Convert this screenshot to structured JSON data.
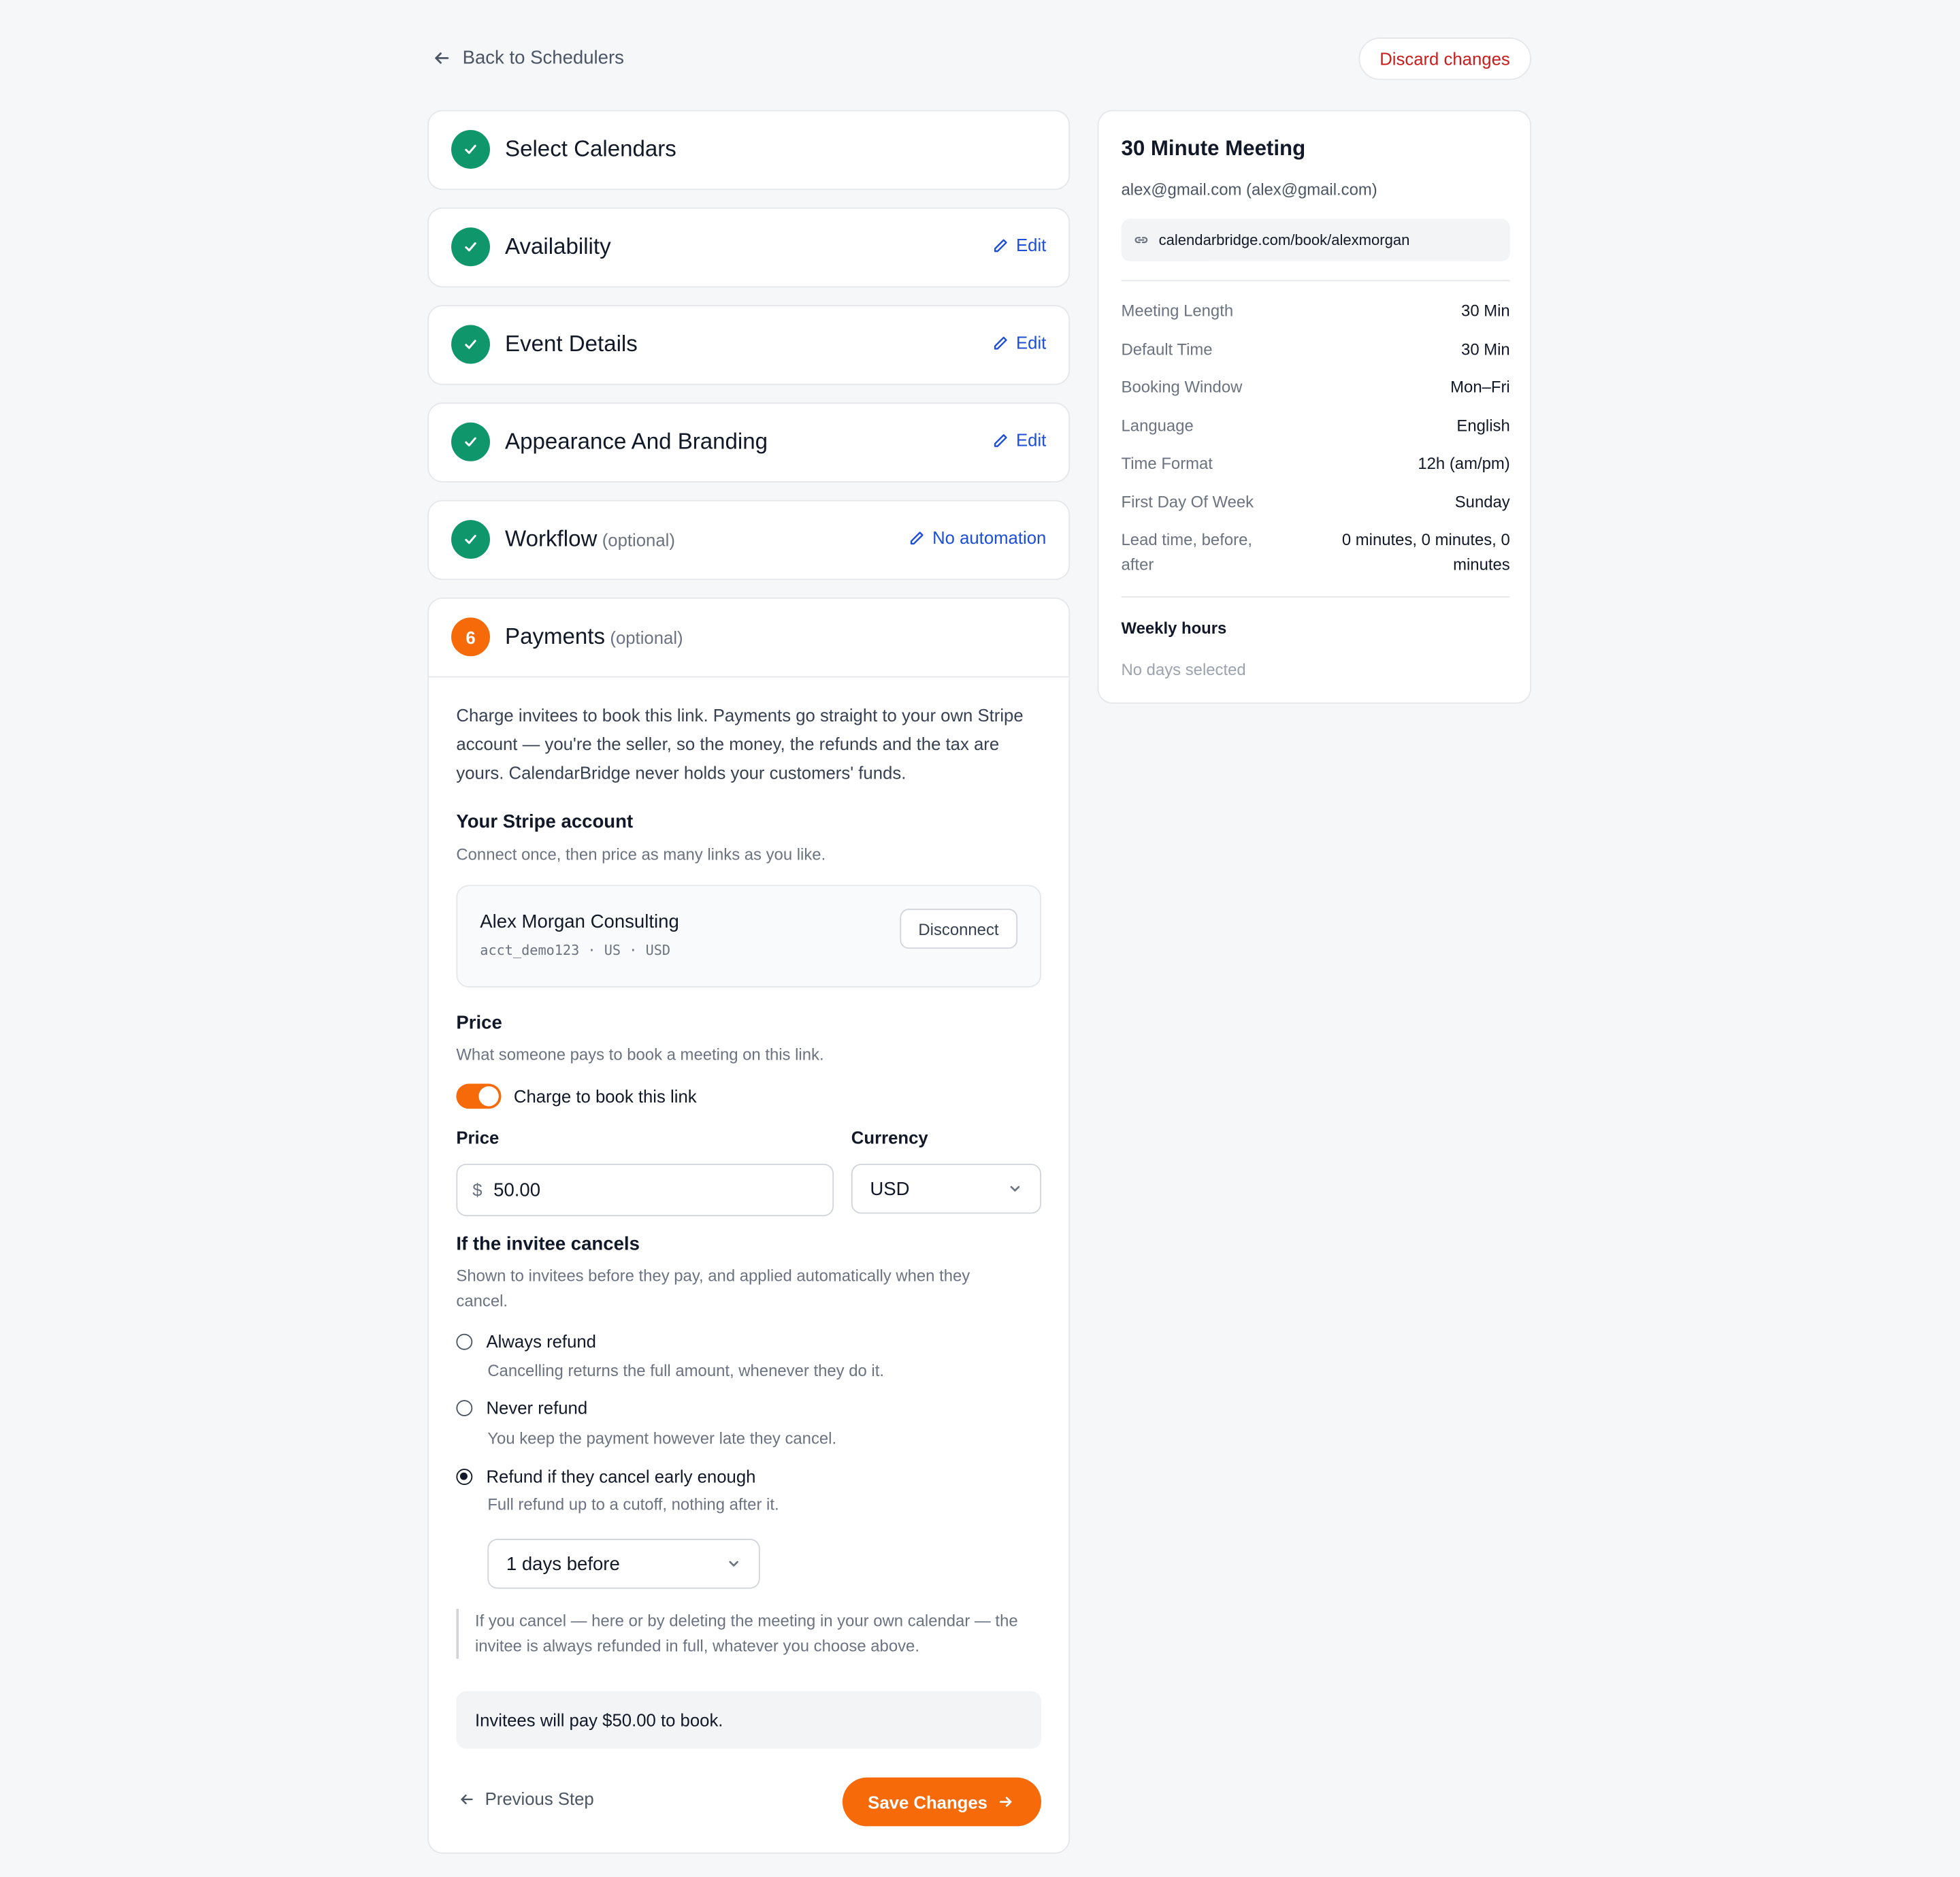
{
  "header": {
    "back_label": "Back to Schedulers",
    "discard_label": "Discard changes"
  },
  "steps": [
    {
      "title": "Select Calendars",
      "optional": "",
      "action": ""
    },
    {
      "title": "Availability",
      "optional": "",
      "action": "Edit"
    },
    {
      "title": "Event Details",
      "optional": "",
      "action": "Edit"
    },
    {
      "title": "Appearance And Branding",
      "optional": "",
      "action": "Edit"
    },
    {
      "title": "Workflow",
      "optional": "(optional)",
      "action": "No automation"
    }
  ],
  "payments": {
    "step_number": "6",
    "title": "Payments",
    "optional": "(optional)",
    "intro": "Charge invitees to book this link. Payments go straight to your own Stripe account — you're the seller, so the money, the refunds and the tax are yours. CalendarBridge never holds your customers' funds.",
    "stripe_heading": "Your Stripe account",
    "stripe_sub": "Connect once, then price as many links as you like.",
    "stripe_account_name": "Alex Morgan Consulting",
    "stripe_account_meta": "acct_demo123 · US · USD",
    "disconnect_label": "Disconnect",
    "price_heading": "Price",
    "price_sub": "What someone pays to book a meeting on this link.",
    "toggle_label": "Charge to book this link",
    "toggle_on": true,
    "price_label": "Price",
    "currency_symbol": "$",
    "price_value": "50.00",
    "currency_label": "Currency",
    "currency_value": "USD",
    "cancel_heading": "If the invitee cancels",
    "cancel_sub": "Shown to invitees before they pay, and applied automatically when they cancel.",
    "refund_options": [
      {
        "label": "Always refund",
        "desc": "Cancelling returns the full amount, whenever they do it.",
        "checked": false
      },
      {
        "label": "Never refund",
        "desc": "You keep the payment however late they cancel.",
        "checked": false
      },
      {
        "label": "Refund if they cancel early enough",
        "desc": "Full refund up to a cutoff, nothing after it.",
        "checked": true
      }
    ],
    "cutoff_value": "1 days before",
    "note": "If you cancel — here or by deleting the meeting in your own calendar — the invitee is always refunded in full, whatever you choose above.",
    "summary": "Invitees will pay $50.00 to book.",
    "prev_label": "Previous Step",
    "save_label": "Save Changes"
  },
  "summary_card": {
    "title": "30 Minute Meeting",
    "email": "alex@gmail.com (alex@gmail.com)",
    "link": "calendarbridge.com/book/alexmorgan",
    "rows": [
      {
        "k": "Meeting Length",
        "v": "30 Min"
      },
      {
        "k": "Default Time",
        "v": "30 Min"
      },
      {
        "k": "Booking Window",
        "v": "Mon–Fri"
      },
      {
        "k": "Language",
        "v": "English"
      },
      {
        "k": "Time Format",
        "v": "12h (am/pm)"
      },
      {
        "k": "First Day Of Week",
        "v": "Sunday"
      },
      {
        "k": "Lead time, before, after",
        "v": "0 minutes, 0 minutes, 0 minutes"
      }
    ],
    "weekly_heading": "Weekly hours",
    "weekly_none": "No days selected"
  },
  "colors": {
    "accent": "#f66a0a",
    "success": "#10966b",
    "link": "#1d4ed8",
    "danger": "#c81e1e"
  }
}
